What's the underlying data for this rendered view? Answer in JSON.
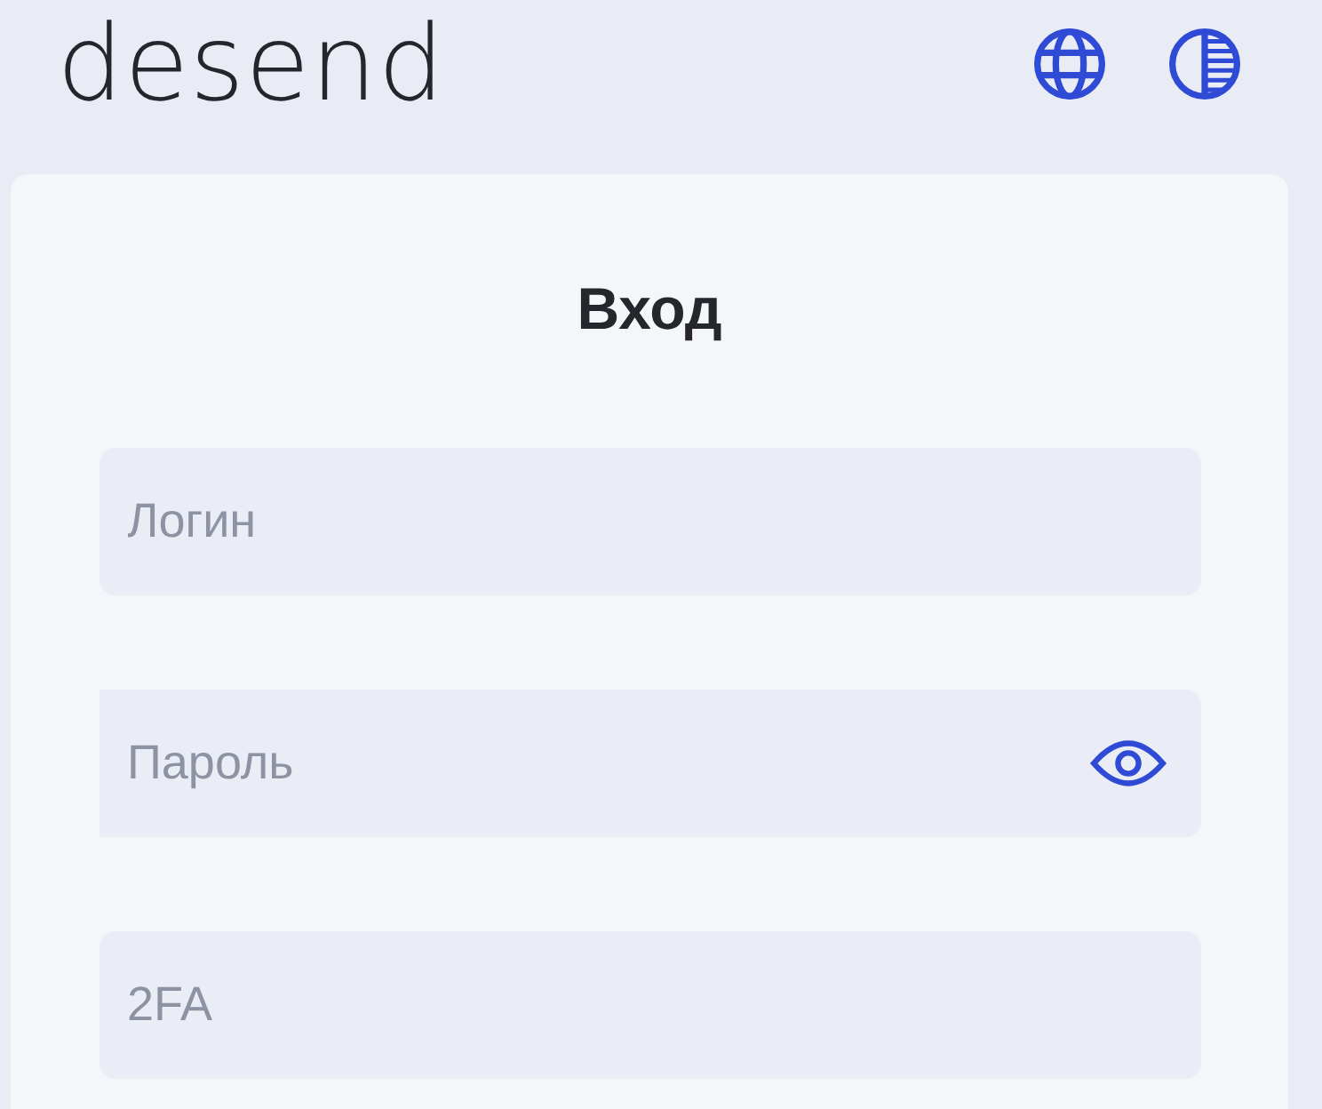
{
  "header": {
    "logo": "desend"
  },
  "card": {
    "title": "Вход",
    "fields": [
      {
        "kind": "text",
        "placeholder": "Логин"
      },
      {
        "kind": "password",
        "placeholder": "Пароль"
      },
      {
        "kind": "text",
        "placeholder": "2FA"
      }
    ]
  }
}
